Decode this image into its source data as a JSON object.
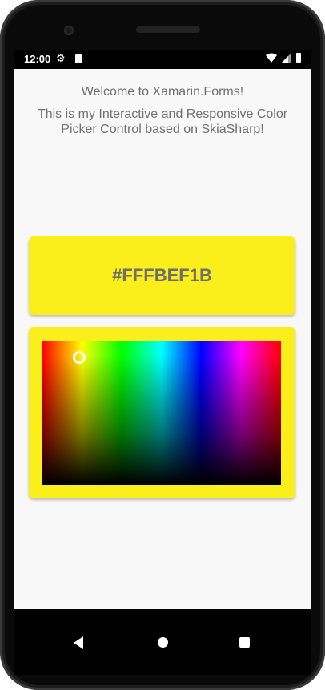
{
  "status_bar": {
    "time": "12:00",
    "icons": [
      "gear-icon",
      "sd-card-icon",
      "wifi-icon",
      "cell-signal-icon",
      "battery-icon"
    ]
  },
  "app": {
    "welcome_text": "Welcome to Xamarin.Forms!",
    "description": "This is my Interactive and Responsive Color Picker Control based on SkiaSharp!"
  },
  "color_display": {
    "hex_value": "#FFFBEF1B",
    "color": "#fbef1b"
  },
  "color_picker": {
    "frame_color": "#fbef1b",
    "selected_color": "#fbef1b",
    "selector_icon": "circle-selector-icon"
  },
  "nav_bar": {
    "buttons": [
      "back-icon",
      "home-icon",
      "recents-icon"
    ]
  },
  "colors": {
    "text": "#707070",
    "hex_text": "#6e6e6e",
    "screen_background": "#f8f8f8"
  }
}
